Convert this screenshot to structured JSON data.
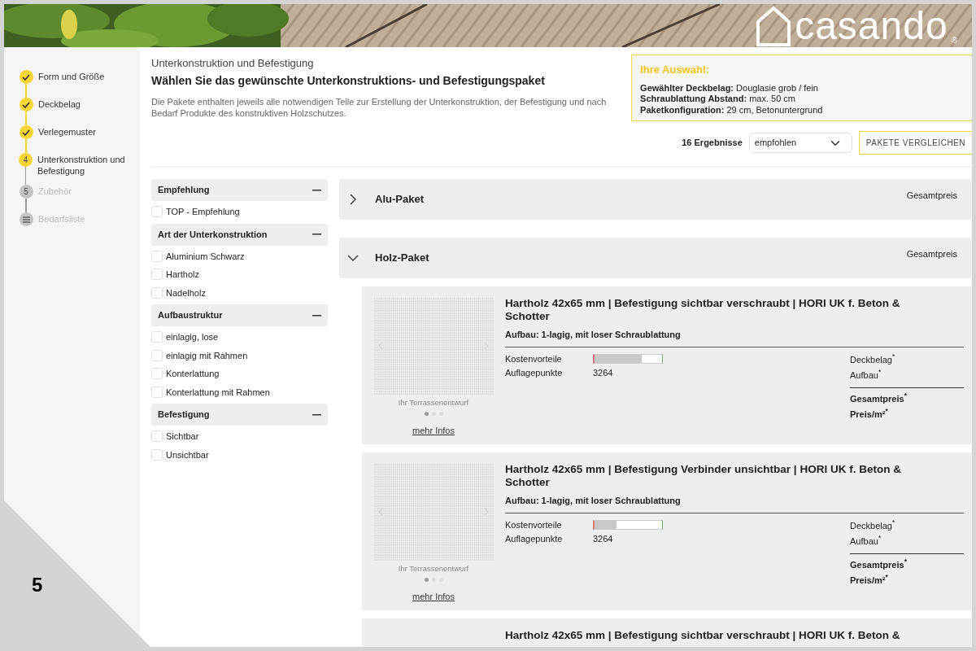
{
  "header": {
    "logo": "casando",
    "registered": "®"
  },
  "steps": [
    {
      "kind": "done",
      "label": "Form und Größe"
    },
    {
      "kind": "done",
      "label": "Deckbelag"
    },
    {
      "kind": "done",
      "label": "Verlegemuster"
    },
    {
      "kind": "current",
      "number": "4",
      "label": "Unterkonstruktion und Befestigung"
    },
    {
      "kind": "upcoming",
      "number": "5",
      "label": "Zubehör"
    },
    {
      "kind": "list",
      "label": "Bedarfsliste"
    }
  ],
  "intro": {
    "kicker": "Unterkonstruktion und Befestigung",
    "title": "Wählen Sie das gewünschte Unterkonstruktions- und Befestigungspaket",
    "description": "Die Pakete enthalten jeweils alle notwendigen Teile zur Erstellung der Unterkonstruktion, der Befestigung und nach Bedarf Produkte des konstruktiven Holzschutzes."
  },
  "selection_box": {
    "title": "Ihre Auswahl:",
    "lines": [
      {
        "label": "Gewählter Deckbelag:",
        "value": "Douglasie grob / fein"
      },
      {
        "label": "Schraublattung Abstand:",
        "value": "max. 50 cm"
      },
      {
        "label": "Paketkonfiguration:",
        "value": "29 cm, Betonuntergrund"
      }
    ]
  },
  "results": {
    "count": "16 Ergebnisse",
    "sort": "empfohlen",
    "compare_button": "PAKETE VERGLEICHEN"
  },
  "filters": [
    {
      "title": "Empfehlung",
      "options": [
        {
          "label": "TOP - Empfehlung",
          "checked": false
        }
      ]
    },
    {
      "title": "Art der Unterkonstruktion",
      "options": [
        {
          "label": "Aluminium Schwarz",
          "checked": false
        },
        {
          "label": "Hartholz",
          "checked": false
        },
        {
          "label": "Nadelholz",
          "checked": false
        }
      ]
    },
    {
      "title": "Aufbaustruktur",
      "options": [
        {
          "label": "einlagig, lose",
          "checked": false
        },
        {
          "label": "einlagig mit Rahmen",
          "checked": false
        },
        {
          "label": "Konterlattung",
          "checked": false
        },
        {
          "label": "Konterlattung mit Rahmen",
          "checked": false
        }
      ]
    },
    {
      "title": "Befestigung",
      "options": [
        {
          "label": "Sichtbar",
          "checked": false
        },
        {
          "label": "Unsichtbar",
          "checked": false
        }
      ]
    }
  ],
  "packages": [
    {
      "name": "Alu-Paket",
      "expanded": false,
      "price_label": "Gesamtpreis"
    },
    {
      "name": "Holz-Paket",
      "expanded": true,
      "price_label": "Gesamtpreis",
      "products": [
        {
          "title": "Hartholz 42x65 mm | Befestigung sichtbar verschraubt | HORI UK f. Beton & Schotter",
          "build": "Aufbau: 1-lagig, mit loser Schraublattung",
          "image_caption": "Ihr Terrassenentwurf",
          "dots": [
            {
              "selected": true
            },
            {
              "selected": false
            },
            {
              "selected": false
            }
          ],
          "more_link": "mehr Infos",
          "cost_label": "Kostenvorteile",
          "cost": {
            "level": 0.7
          },
          "support_label": "Auflagepunkte",
          "support_value": "3264",
          "prices": [
            "Deckbelag$^{*}$",
            "Aufbau$^{*}$",
            "Gesamtpreis$^{*}$",
            "Preis/m²$^{*}$"
          ]
        },
        {
          "title": "Hartholz 42x65 mm | Befestigung Verbinder unsichtbar | HORI UK f. Beton & Schotter",
          "build": "Aufbau: 1-lagig, mit loser Schraublattung",
          "image_caption": "Ihr Terrassenentwurf",
          "dots": [
            {
              "selected": true
            },
            {
              "selected": false
            },
            {
              "selected": false
            }
          ],
          "more_link": "mehr Infos",
          "cost_label": "Kostenvorteile",
          "cost": {
            "level": 0.33
          },
          "support_label": "Auflagepunkte",
          "support_value": "3264",
          "prices": [
            "Deckbelag$^{*}$",
            "Aufbau$^{*}$",
            "Gesamtpreis$^{*}$",
            "Preis/m²$^{*}$"
          ]
        },
        {
          "title": "Hartholz 42x65 mm | Befestigung sichtbar verschraubt | HORI UK f. Beton &"
        }
      ]
    }
  ],
  "corner_label": "5"
}
